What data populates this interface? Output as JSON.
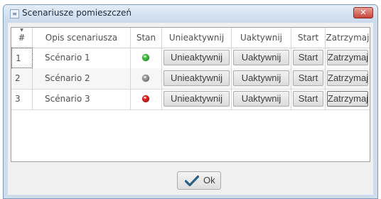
{
  "window": {
    "title": "Scenariusze pomieszczeń",
    "close_label": "✕"
  },
  "grid": {
    "columns": [
      "#",
      "Opis scenariusza",
      "Stan",
      "Unieaktywnij",
      "Uaktywnij",
      "Start",
      "Zatrzymaj"
    ],
    "rows": [
      {
        "num": "1",
        "desc": "Scénario 1",
        "status": "green",
        "deactivate": "Unieaktywnij",
        "activate": "Uaktywnij",
        "start": "Start",
        "stop": "Zatrzymaj"
      },
      {
        "num": "2",
        "desc": "Scénario 2",
        "status": "gray",
        "deactivate": "Unieaktywnij",
        "activate": "Uaktywnij",
        "start": "Start",
        "stop": "Zatrzymaj"
      },
      {
        "num": "3",
        "desc": "Scénario 3",
        "status": "red",
        "deactivate": "Unieaktywnij",
        "activate": "Uaktywnij",
        "start": "Start",
        "stop": "Zatrzymaj"
      }
    ]
  },
  "status_colors": {
    "green": "#3cc43c",
    "gray": "#9a9a9a",
    "red": "#e02020"
  },
  "footer": {
    "ok_label": "Ok",
    "ok_icon": "checkmark-icon"
  }
}
